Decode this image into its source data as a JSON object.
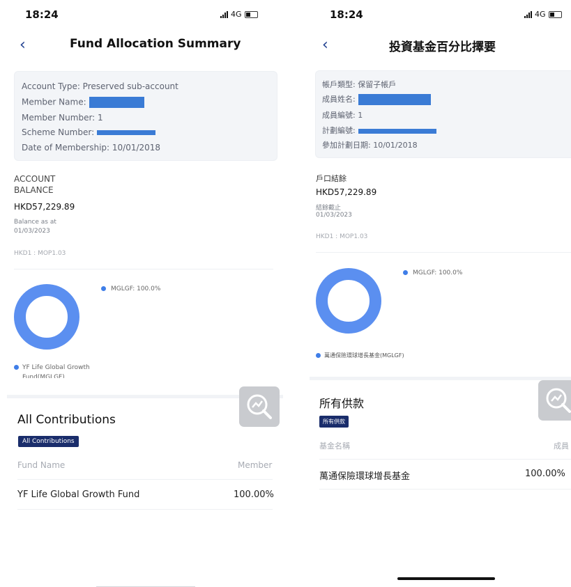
{
  "status_bar": {
    "time": "18:24",
    "network": "4G"
  },
  "left": {
    "title": "Fund Allocation Summary",
    "account_type": "Account Type: Preserved sub-account",
    "member_name_label": "Member Name:",
    "member_number": "Member Number: 1",
    "scheme_number_label": "Scheme Number:",
    "date_of_membership": "Date of Membership: 10/01/2018",
    "balance_heading_line1": "ACCOUNT",
    "balance_heading_line2": "BALANCE",
    "balance_value": "HKD57,229.89",
    "balance_as_at_label": "Balance as at",
    "balance_date": "01/03/2023",
    "exchange_rate": "HKD1 : MOP1.03",
    "legend_inline": "MGLGF: 100.0%",
    "legend_fund_line1": "YF Life Global Growth",
    "legend_fund_line2": "Fund(MGLGF)",
    "contrib_title": "All Contributions",
    "contrib_badge": "All Contributions",
    "col_fund_name": "Fund Name",
    "col_member": "Member",
    "rows": [
      {
        "fund": "YF Life Global Growth Fund",
        "member": "100.00%"
      }
    ]
  },
  "right": {
    "title": "投資基金百分比擇要",
    "account_type": "帳戶類型: 保留子帳戶",
    "member_name_label": "成員姓名:",
    "member_number": "成員編號: 1",
    "scheme_number_label": "計劃編號:",
    "date_of_membership": "參加計劃日期: 10/01/2018",
    "balance_heading": "戶口結餘",
    "balance_value": "HKD57,229.89",
    "balance_as_at_label": "結餘截止",
    "balance_date": "01/03/2023",
    "exchange_rate": "HKD1 : MOP1.03",
    "legend_inline": "MGLGF: 100.0%",
    "legend_fund": "萬通保險環球增長基金(MGLGF)",
    "contrib_title": "所有供款",
    "contrib_badge": "所有供款",
    "col_fund_name": "基金名稱",
    "col_member": "成員",
    "rows": [
      {
        "fund": "萬通保險環球增長基金",
        "member": "100.00%"
      }
    ]
  },
  "chart_data": {
    "type": "pie",
    "categories": [
      "MGLGF"
    ],
    "values": [
      100.0
    ],
    "series": [
      {
        "name": "YF Life Global Growth Fund(MGLGF)",
        "values": [
          100.0
        ]
      }
    ]
  },
  "colors": {
    "accent": "#3f7ee8",
    "badge": "#1a2d6b",
    "redaction": "#3a7bd5",
    "back": "#1f3f8f"
  },
  "icons": {
    "back": "chevron-left-icon",
    "fab": "search-chart-icon",
    "signal": "signal-icon",
    "battery": "battery-icon"
  }
}
